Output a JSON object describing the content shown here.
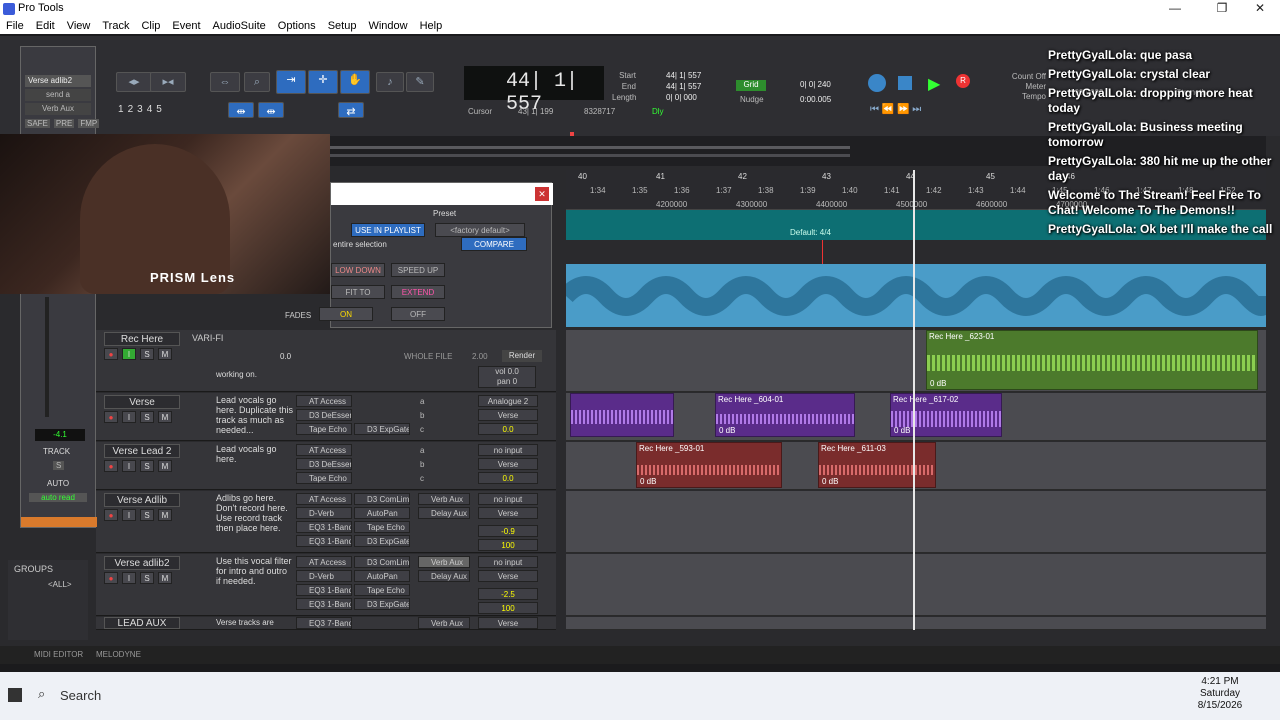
{
  "window": {
    "title": "Pro Tools"
  },
  "menu": [
    "File",
    "Edit",
    "View",
    "Track",
    "Clip",
    "Event",
    "AudioSuite",
    "Options",
    "Setup",
    "Window",
    "Help"
  ],
  "toolbar": {
    "counter": "44| 1| 557",
    "start_label": "Start",
    "end_label": "End",
    "length_label": "Length",
    "start_val": "44| 1| 557",
    "end_val": "44| 1| 557",
    "length_val": "0| 0| 000",
    "cursor_label": "Cursor",
    "cursor_val": "43| 1| 199",
    "sample_val": "8328717",
    "grid_label": "Grid",
    "grid_val": "0| 0| 240",
    "nudge_label": "Nudge",
    "nudge_val": "0:00.005",
    "count_off": "Count Off",
    "meter": "Meter",
    "tempo": "Tempo",
    "tempo_val": "100.0000",
    "strength_label": "Strength:",
    "strength_val": "100%",
    "nums": [
      "1",
      "2",
      "3",
      "4",
      "5"
    ],
    "dly": "Dly"
  },
  "chat": [
    {
      "user": "PrettyGyalLola:",
      "text": " que pasa"
    },
    {
      "user": "PrettyGyalLola:",
      "text": " crystal clear"
    },
    {
      "user": "PrettyGyalLola:",
      "text": " dropping more heat today"
    },
    {
      "user": "PrettyGyalLola:",
      "text": " Business meeting tomorrow"
    },
    {
      "user": "PrettyGyalLola:",
      "text": " 380 hit me up the other day"
    },
    {
      "user": "",
      "text": " Welcome to The Stream! Feel Free To Chat! Welcome To The Demons!!"
    },
    {
      "user": "PrettyGyalLola:",
      "text": " Ok bet I'll make the call"
    }
  ],
  "webcam": {
    "label": "PRISM Lens"
  },
  "leftpanel": {
    "track": "Verse adlib2",
    "send": "send a",
    "aux": "Verb Aux",
    "safe": "SAFE",
    "pre": "PRE",
    "fmp": "FMP",
    "level": "-4.1",
    "track_lbl": "TRACK",
    "s": "S",
    "auto": "AUTO",
    "auto_read": "auto read"
  },
  "plugin": {
    "preset": "Preset",
    "use_in_playlist": "USE IN PLAYLIST",
    "factory_default": "<factory default>",
    "entire_selection": "entire selection",
    "compare": "COMPARE",
    "slow_down": "LOW DOWN",
    "speed_up": "SPEED UP",
    "fit_to": "FIT TO",
    "extend": "EXTEND",
    "fades": "FADES",
    "on": "ON",
    "off": "OFF"
  },
  "ruler": {
    "bars": [
      "40",
      "41",
      "42",
      "43",
      "44",
      "45",
      "46"
    ],
    "times": [
      "1:34",
      "1:35",
      "1:36",
      "1:37",
      "1:38",
      "1:39",
      "1:40",
      "1:41",
      "1:42",
      "1:43",
      "1:44",
      "1:45",
      "1:46",
      "1:47",
      "1:48",
      "1:52"
    ],
    "samples": [
      "4200000",
      "4300000",
      "4400000",
      "4500000",
      "4600000",
      "4700000"
    ],
    "default_meter": "Default: 4/4"
  },
  "tracks": [
    {
      "name": "Rec Here",
      "mode": "VARI-FI",
      "comment": "working on.",
      "vol": "0.0",
      "pan": "0",
      "wholefile": "WHOLE FILE",
      "render": "Render",
      "value": "2.00",
      "val0": "0.0"
    },
    {
      "name": "Verse",
      "comment": "Lead vocals go here. Duplicate this track as much as needed...",
      "inserts": [
        "AT Access",
        "D3 DeEsser",
        "Tape Echo",
        "D3 ExpGate"
      ],
      "sends": [
        "a",
        "b",
        "c"
      ],
      "io": [
        "Analogue 2",
        "Verse"
      ],
      "vol": "0.0",
      "pan": "0"
    },
    {
      "name": "Verse Lead 2",
      "comment": "Lead vocals go here.",
      "inserts": [
        "AT Access",
        "D3 DeEsser",
        "Tape Echo"
      ],
      "sends": [
        "a",
        "b",
        "c"
      ],
      "io": [
        "no input",
        "Verse"
      ],
      "vol": "0.0",
      "pan": "0"
    },
    {
      "name": "Verse Adlib",
      "comment": "Adlibs go here. Don't record here. Use record track then place here.",
      "inserts": [
        "AT Access",
        "D-Verb",
        "EQ3 1-Band",
        "EQ3 1-Band",
        "D3 ComLim",
        "AutoPan",
        "Tape Echo",
        "D3 ExpGate"
      ],
      "sends": [
        "Verb Aux",
        "Delay Aux"
      ],
      "io": [
        "no input",
        "Verse"
      ],
      "vol": "-0.9",
      "pan": "100"
    },
    {
      "name": "Verse adlib2",
      "comment": "Use this vocal filter for intro and outro if needed.",
      "inserts": [
        "AT Access",
        "D-Verb",
        "EQ3 1-Band",
        "EQ3 1-Band",
        "D3 ComLim",
        "AutoPan",
        "Tape Echo",
        "D3 ExpGate"
      ],
      "sends": [
        "Verb Aux",
        "Delay Aux"
      ],
      "io": [
        "no input",
        "Verse"
      ],
      "vol": "-2.5",
      "pan": "100"
    },
    {
      "name": "LEAD AUX",
      "comment": "Verse tracks are",
      "inserts": [
        "EQ3 7-Band"
      ],
      "sends": [
        "Verb Aux"
      ],
      "io": [
        "Verse"
      ]
    }
  ],
  "track_btns": {
    "s": "S",
    "m": "M",
    "wave": "wave",
    "read": "read",
    "vol": "vol",
    "pan": "pan"
  },
  "clips": [
    {
      "name": "Rec Here _623-01",
      "db": "0 dB"
    },
    {
      "name": "Rec Here _604-01",
      "db": "0 dB"
    },
    {
      "name": "Rec Here _617-02",
      "db": "0 dB"
    },
    {
      "name": "Rec Here _593-01",
      "db": "0 dB"
    },
    {
      "name": "Rec Here _611-03",
      "db": "0 dB"
    }
  ],
  "groups": {
    "title": "GROUPS",
    "all": "<ALL>"
  },
  "bottom": {
    "midi": "MIDI EDITOR",
    "melodyne": "MELODYNE"
  },
  "taskbar": {
    "search": "Search",
    "time": "4:21 PM",
    "day": "Saturday",
    "date": "8/15/2026"
  },
  "colors": {
    "teal": "#0d6f73",
    "blue_wave": "#4aa8d8",
    "green_wave": "#7fc44a",
    "purple_wave": "#8a4ad0",
    "red_wave": "#b04a4a"
  }
}
